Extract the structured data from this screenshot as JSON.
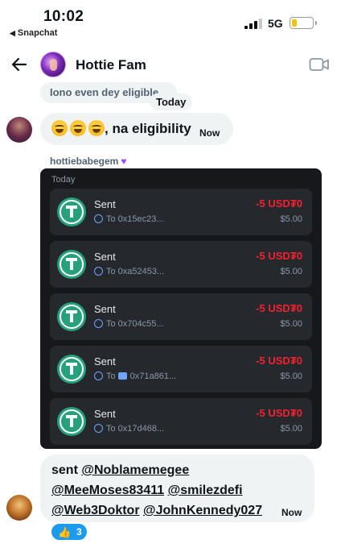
{
  "status_bar": {
    "time": "10:02",
    "back_app": "Snapchat",
    "network": "5G",
    "battery_level": 0.25,
    "colors": {
      "battery": "#f5c400"
    }
  },
  "header": {
    "title": "Hottie Fam",
    "icons": [
      "back-arrow-icon",
      "video-call-icon"
    ]
  },
  "messages": {
    "previous": "Iono even dey eligible",
    "date_pill": "Today",
    "reply": {
      "text": ", na eligibility",
      "emoji": "😂😂😂",
      "time": "Now"
    },
    "sender": "hottiebabegem",
    "card": {
      "date": "Today",
      "transactions": [
        {
          "label": "Sent",
          "to": "To 0x15ec23...",
          "amount": "-5 USD₮0",
          "usd": "$5.00"
        },
        {
          "label": "Sent",
          "to": "To 0xa52453...",
          "amount": "-5 USD₮0",
          "usd": "$5.00"
        },
        {
          "label": "Sent",
          "to": "To 0x704c55...",
          "amount": "-5 USD₮0",
          "usd": "$5.00"
        },
        {
          "label": "Sent",
          "to_prefix": "To",
          "to": "0x71a861...",
          "amount": "-5 USD₮0",
          "usd": "$5.00"
        },
        {
          "label": "Sent",
          "to": "To 0x17d468...",
          "amount": "-5 USD₮0",
          "usd": "$5.00"
        }
      ]
    },
    "last": {
      "prefix": "sent",
      "mentions": [
        "@Noblamemegee",
        "@MeeMoses83411",
        "@smilezdefi",
        "@Web3Doktor",
        "@JohnKennedy027"
      ],
      "time": "Now",
      "reaction": {
        "emoji": "👍",
        "count": "3"
      }
    }
  },
  "colors": {
    "accent": "#1d9bf0",
    "negative_amount": "#f4212e",
    "tether": "#26a17b",
    "card_bg": "#16181c",
    "bubble_bg": "#eff3f4"
  }
}
